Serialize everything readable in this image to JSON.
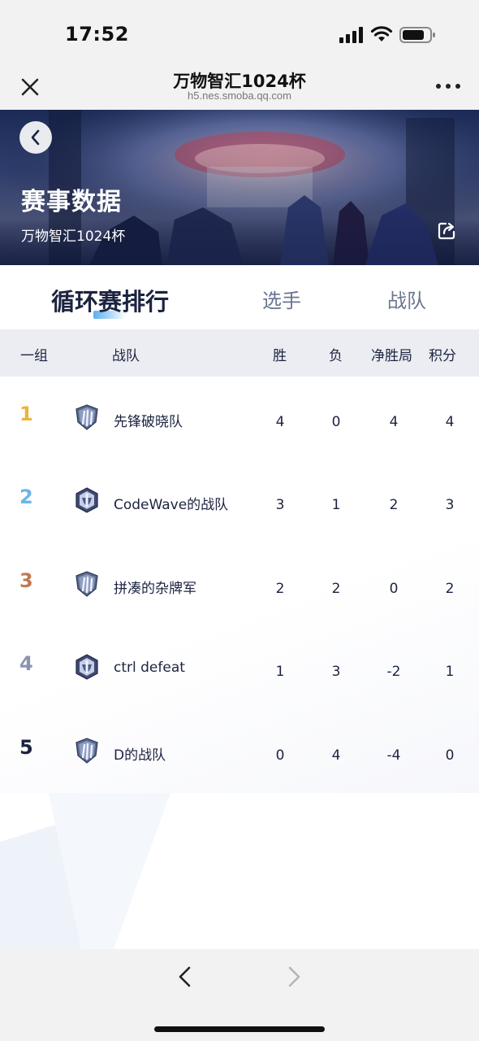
{
  "status_bar": {
    "time": "17:52"
  },
  "browser": {
    "title": "万物智汇1024杯",
    "url": "h5.nes.smoba.qq.com"
  },
  "banner": {
    "title": "赛事数据",
    "subtitle": "万物智汇1024杯"
  },
  "tabs": [
    {
      "label": "循环赛排行",
      "active": true
    },
    {
      "label": "选手",
      "active": false
    },
    {
      "label": "战队",
      "active": false
    }
  ],
  "table": {
    "headers": {
      "group": "一组",
      "team": "战队",
      "wins": "胜",
      "losses": "负",
      "net": "净胜局",
      "points": "积分"
    },
    "rows": [
      {
        "rank": "1",
        "team": "先锋破晓队",
        "wins": "4",
        "losses": "0",
        "net": "4",
        "points": "4",
        "rank_color": "#e9b53d",
        "logo": "shield-claw-icon"
      },
      {
        "rank": "2",
        "team": "CodeWave的战队",
        "wins": "3",
        "losses": "1",
        "net": "2",
        "points": "3",
        "rank_color": "#6ab6e6",
        "logo": "helmet-icon"
      },
      {
        "rank": "3",
        "team": "拼凑的杂牌军",
        "wins": "2",
        "losses": "2",
        "net": "0",
        "points": "2",
        "rank_color": "#c07a52",
        "logo": "shield-claw-icon"
      },
      {
        "rank": "4",
        "team": "ctrl defeat",
        "wins": "1",
        "losses": "3",
        "net": "-2",
        "points": "1",
        "rank_color": "#8a94b0",
        "logo": "helmet-icon"
      },
      {
        "rank": "5",
        "team": "D的战队",
        "wins": "0",
        "losses": "4",
        "net": "-4",
        "points": "0",
        "rank_color": "#1c2340",
        "logo": "shield-claw-icon"
      }
    ]
  }
}
